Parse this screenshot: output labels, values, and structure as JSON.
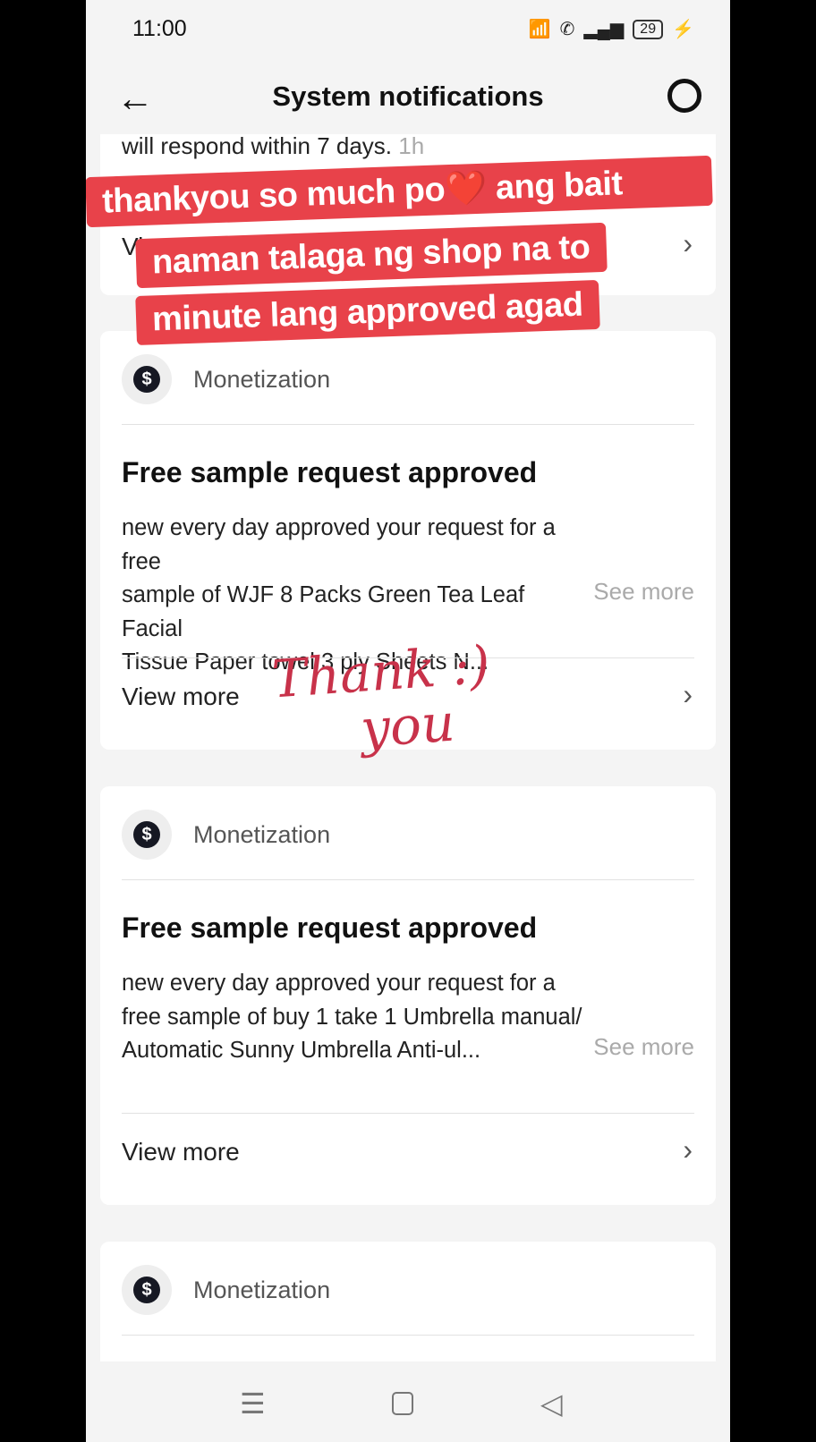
{
  "status": {
    "time": "11:00",
    "battery": "29"
  },
  "header": {
    "title": "System notifications"
  },
  "top_card": {
    "text": "will respond within 7 days.",
    "time": "1h",
    "link": "View more"
  },
  "notifications": [
    {
      "category": "Monetization",
      "title": "Free sample request approved",
      "lines": [
        "new every day approved your request for a free",
        "sample of WJF 8 Packs Green Tea Leaf Facial",
        "Tissue Paper towel 3 ply Sheets N..."
      ],
      "see_more": "See more",
      "view_more": "View more"
    },
    {
      "category": "Monetization",
      "title": "Free sample request approved",
      "lines": [
        "new every day approved your request for a",
        "free sample of buy 1 take 1 Umbrella manual/",
        "Automatic Sunny Umbrella Anti-ul..."
      ],
      "see_more": "See more",
      "view_more": "View more"
    },
    {
      "category": "Monetization"
    }
  ],
  "overlay": {
    "caption": [
      "thankyou so much po❤️ ang bait",
      "naman talaga ng shop na to",
      "minute lang approved agad"
    ],
    "handwriting": [
      "Thank :)",
      "you"
    ]
  },
  "colors": {
    "caption_bg": "#e8424a",
    "handwriting": "#c8324a"
  }
}
